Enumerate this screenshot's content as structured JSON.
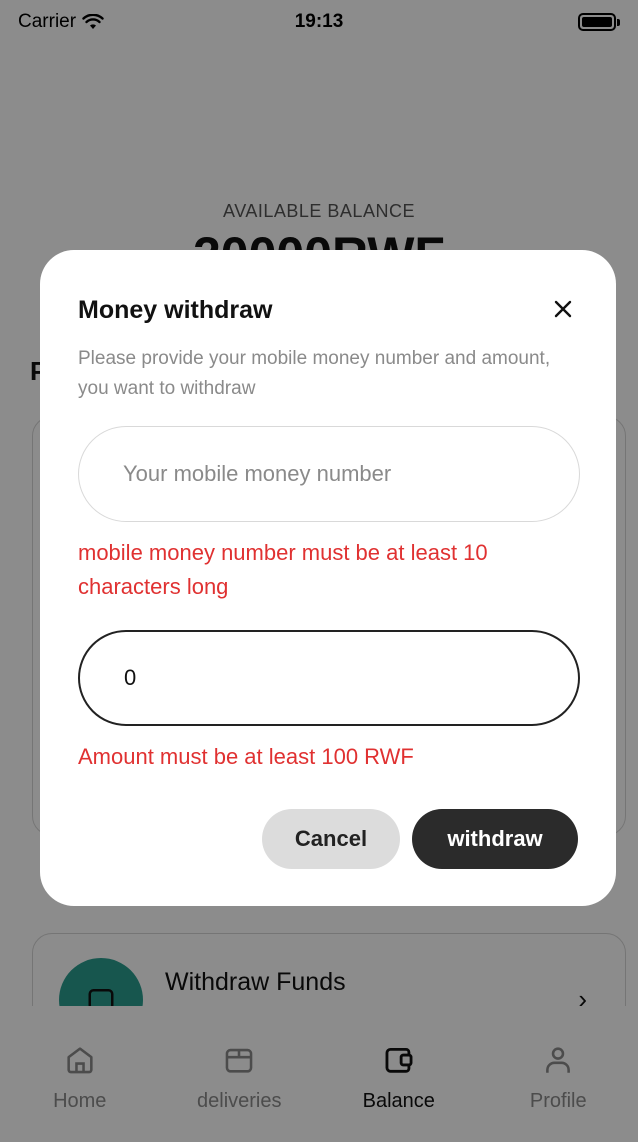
{
  "status_bar": {
    "carrier": "Carrier",
    "time": "19:13"
  },
  "balance": {
    "label": "AVAILABLE BALANCE",
    "amount": "20000RWF"
  },
  "section": {
    "letter": "P"
  },
  "withdraw_funds": {
    "title": "Withdraw Funds"
  },
  "nav": {
    "items": [
      {
        "label": "Home",
        "icon": "home-icon"
      },
      {
        "label": "deliveries",
        "icon": "package-icon"
      },
      {
        "label": "Balance",
        "icon": "wallet-icon",
        "active": true
      },
      {
        "label": "Profile",
        "icon": "user-icon"
      }
    ]
  },
  "modal": {
    "title": "Money withdraw",
    "description": "Please provide your mobile money number and amount, you want to withdraw",
    "phone": {
      "placeholder": "Your mobile money number",
      "value": "",
      "error": "mobile money number must be at least 10 characters long"
    },
    "amount": {
      "value": "0",
      "error": "Amount must be at least 100 RWF"
    },
    "cancel_label": "Cancel",
    "withdraw_label": "withdraw"
  },
  "colors": {
    "error": "#e03131",
    "primary_button": "#2b2b2b",
    "accent_teal": "#2a9d8f"
  }
}
